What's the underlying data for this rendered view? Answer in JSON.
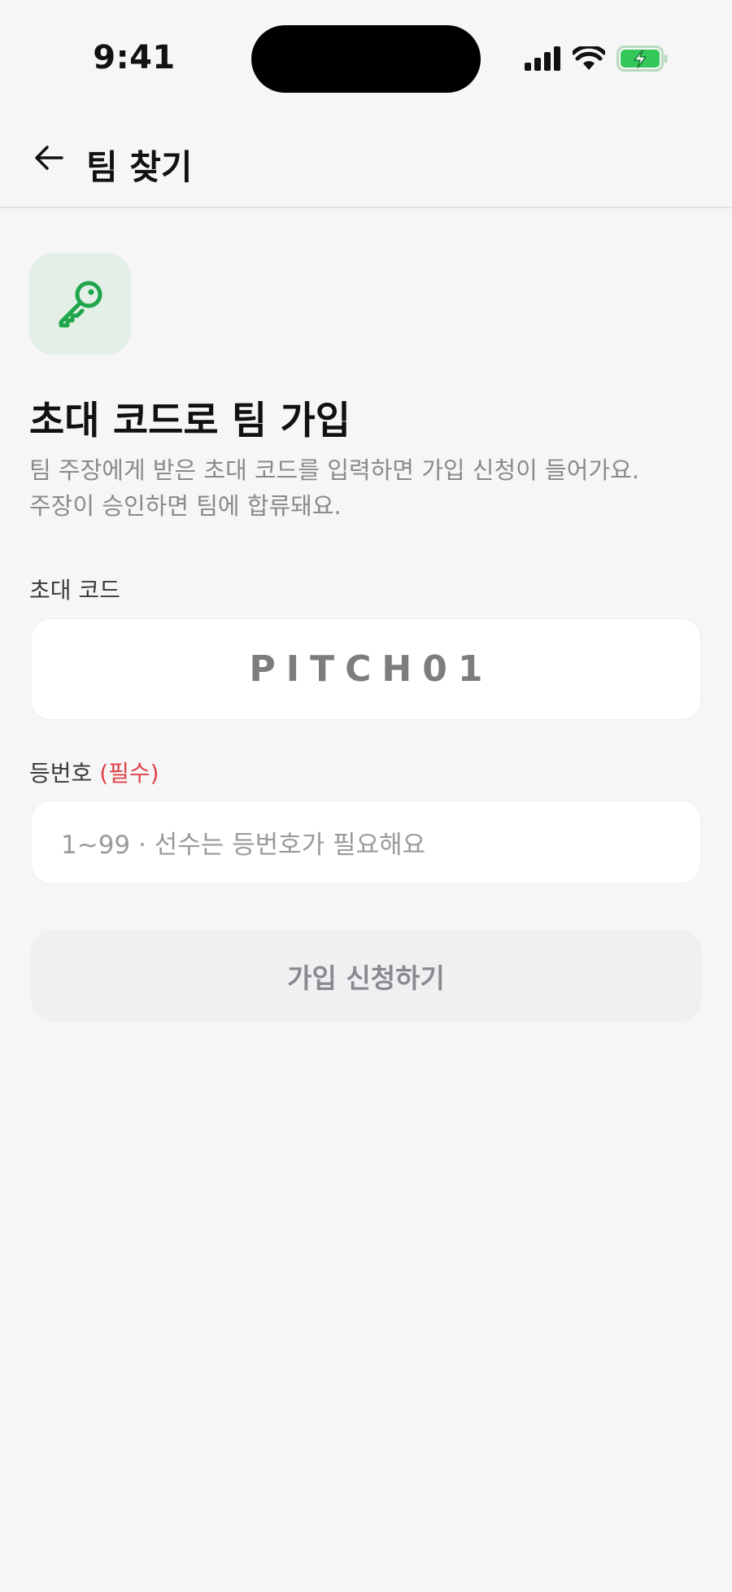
{
  "status_bar": {
    "time": "9:41",
    "icons": [
      "cellular-signal-icon",
      "wifi-icon",
      "battery-charging-icon"
    ]
  },
  "header": {
    "back_icon": "arrow-left-icon",
    "title": "팀 찾기"
  },
  "hero": {
    "icon": "key-icon",
    "icon_color": "#1fa64a",
    "icon_bg": "#e3efe7",
    "title": "초대 코드로 팀 가입",
    "description_line1": "팀 주장에게 받은 초대 코드를 입력하면 가입 신청이 들어가요.",
    "description_line2": "주장이 승인하면 팀에 합류돼요."
  },
  "form": {
    "code_label": "초대 코드",
    "code_value": "PITCH01",
    "number_label": "등번호",
    "number_required": "(필수)",
    "number_placeholder": "1~99 · 선수는 등번호가 필요해요",
    "required_color": "#e0424b"
  },
  "actions": {
    "submit_label": "가입 신청하기"
  }
}
